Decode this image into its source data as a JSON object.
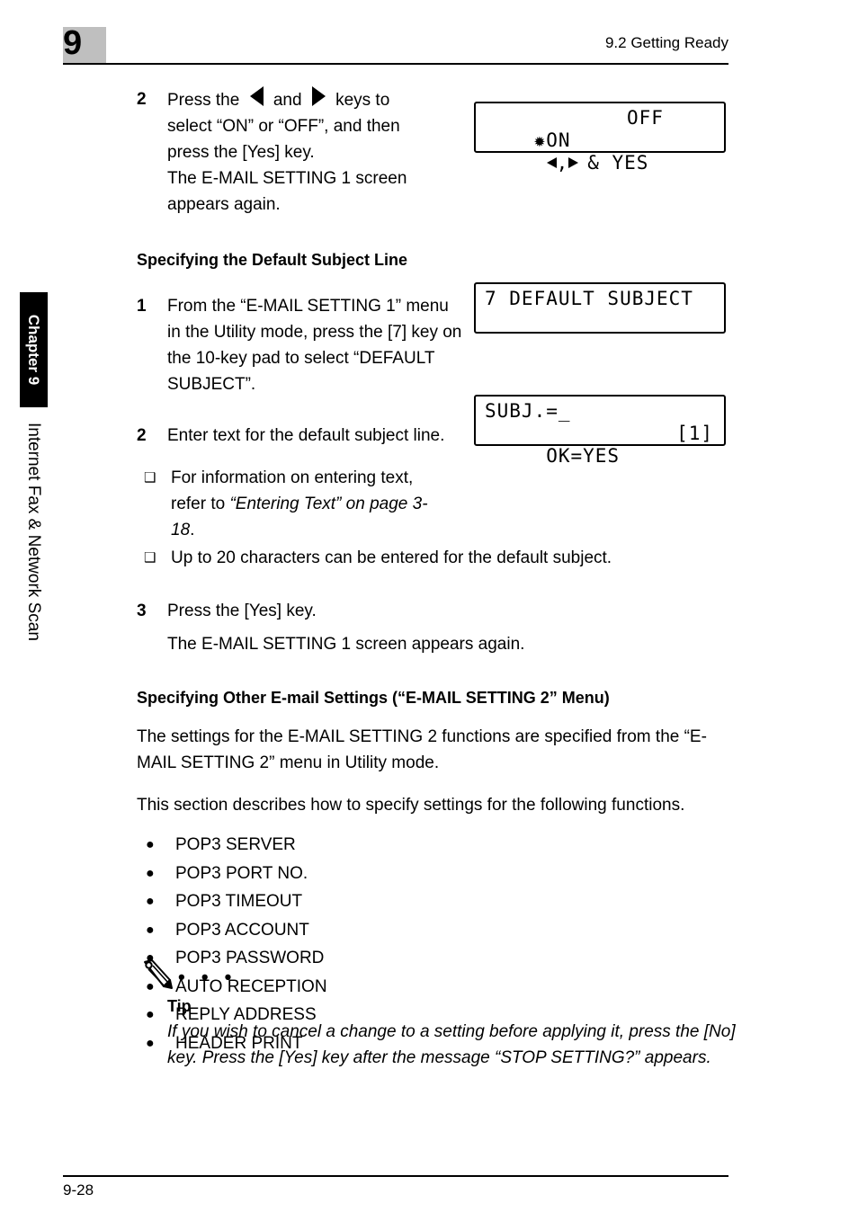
{
  "header": {
    "chapter_number": "9",
    "section_title": "9.2 Getting Ready"
  },
  "sidebar": {
    "tab_label": "Chapter 9",
    "running_head": "Internet Fax & Network Scan"
  },
  "footer": {
    "page_number": "9-28"
  },
  "content": {
    "step_2a": {
      "number": "2",
      "line_1_pre": "Press the ",
      "line_1_mid": " and ",
      "line_1_post": " keys to",
      "line_2": "select “ON” or “OFF”, and then",
      "line_3": "press the [Yes] key.",
      "line_4": "The E-MAIL SETTING 1 screen",
      "line_5": "appears again."
    },
    "section_heading_1": "Specifying the Default Subject Line",
    "step_1": {
      "number": "1",
      "text": "From the “E-MAIL SETTING 1” menu in the Utility mode, press the [7] key on the 10-key pad to select “DEFAULT SUBJECT”."
    },
    "step_2b": {
      "number": "2",
      "text": "Enter text for the default subject line."
    },
    "step_2b_subitems": [
      {
        "bullet": "❑",
        "text_plain": "For information on entering text, refer to ",
        "text_italic": "“Entering Text” on page 3-18",
        "text_tail": "."
      },
      {
        "bullet": "❑",
        "text_plain": "Up to 20 characters can be entered for the default subject.",
        "text_italic": "",
        "text_tail": ""
      }
    ],
    "step_3": {
      "number": "3",
      "text": "Press the [Yes] key.",
      "result": "The E-MAIL SETTING 1 screen appears again."
    },
    "section_heading_2": "Specifying Other E-mail Settings (“E-MAIL SETTING 2” Menu)",
    "paragraph_1": "The settings for the E-MAIL SETTING 2 functions are specified from the “E-MAIL SETTING 2” menu in Utility mode.",
    "paragraph_2": "This section describes how to specify settings for the following functions.",
    "function_list": [
      "POP3 SERVER",
      "POP3 PORT NO.",
      "POP3 TIMEOUT",
      "POP3 ACCOUNT",
      "POP3 PASSWORD",
      "AUTO RECEPTION",
      "REPLY ADDRESS",
      "HEADER PRINT"
    ],
    "function_bullet": "●",
    "tip": {
      "dots": "• • •",
      "label": "Tip",
      "text": "If you wish to cancel a change to a setting before applying it, press the [No] key. Press the [Yes] key after the message “STOP SETTING?” appears."
    }
  },
  "lcd_panels": [
    {
      "id": "on-off-select",
      "row_1_left": "✹ON",
      "row_1_mid": "OFF",
      "row_2_tail": "& YES"
    },
    {
      "id": "default-subject-menu",
      "row_1_left": "7 DEFAULT SUBJECT",
      "row_2_left": ""
    },
    {
      "id": "subject-entry",
      "row_1_left": "SUBJ.=_",
      "row_2_left": " OK=YES",
      "row_2_right": "[1]"
    }
  ],
  "colors": {
    "page_background": "#ffffff",
    "text": "#000000",
    "chapter_box": "#bfbfbf",
    "tab_background": "#000000",
    "tab_text": "#ffffff"
  }
}
